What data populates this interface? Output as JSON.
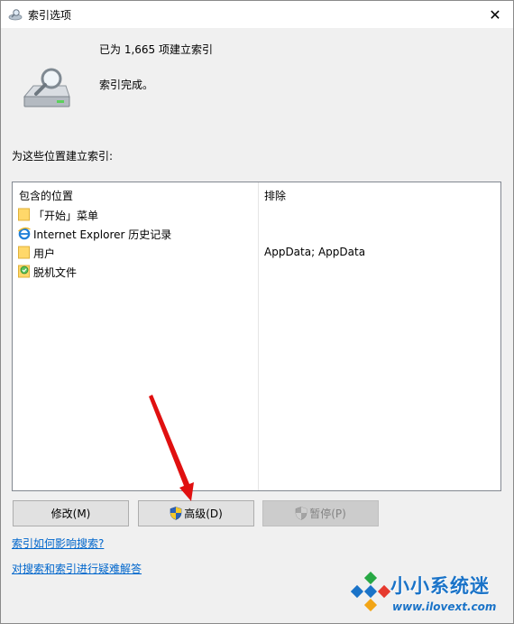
{
  "window": {
    "title": "索引选项",
    "close_symbol": "✕",
    "title_icon": "indexing-options-icon"
  },
  "summary": {
    "indexed_count": "已为 1,665 项建立索引",
    "status": "索引完成。",
    "icon": "drive-magnifier-icon"
  },
  "locations": {
    "section_label": "为这些位置建立索引:",
    "column_included": "包含的位置",
    "column_excluded": "排除",
    "items": [
      {
        "name": "「开始」菜单",
        "excluded": "",
        "icon": "folder-icon"
      },
      {
        "name": "Internet Explorer 历史记录",
        "excluded": "",
        "icon": "internet-explorer-icon"
      },
      {
        "name": "用户",
        "excluded": "AppData; AppData",
        "icon": "folder-icon"
      },
      {
        "name": "脱机文件",
        "excluded": "",
        "icon": "offline-files-icon"
      }
    ]
  },
  "buttons": {
    "modify": "修改(M)",
    "advanced": "高级(D)",
    "pause": "暂停(P)"
  },
  "links": {
    "how_indexing_affects": "索引如何影响搜索?",
    "troubleshoot": "对搜索和索引进行疑难解答"
  },
  "watermark": {
    "brand": "小小系统迷",
    "url": "www.ilovext.com"
  },
  "colors": {
    "link": "#0066cc",
    "watermark": "#1a73c8",
    "annotation_arrow": "#e01010"
  }
}
